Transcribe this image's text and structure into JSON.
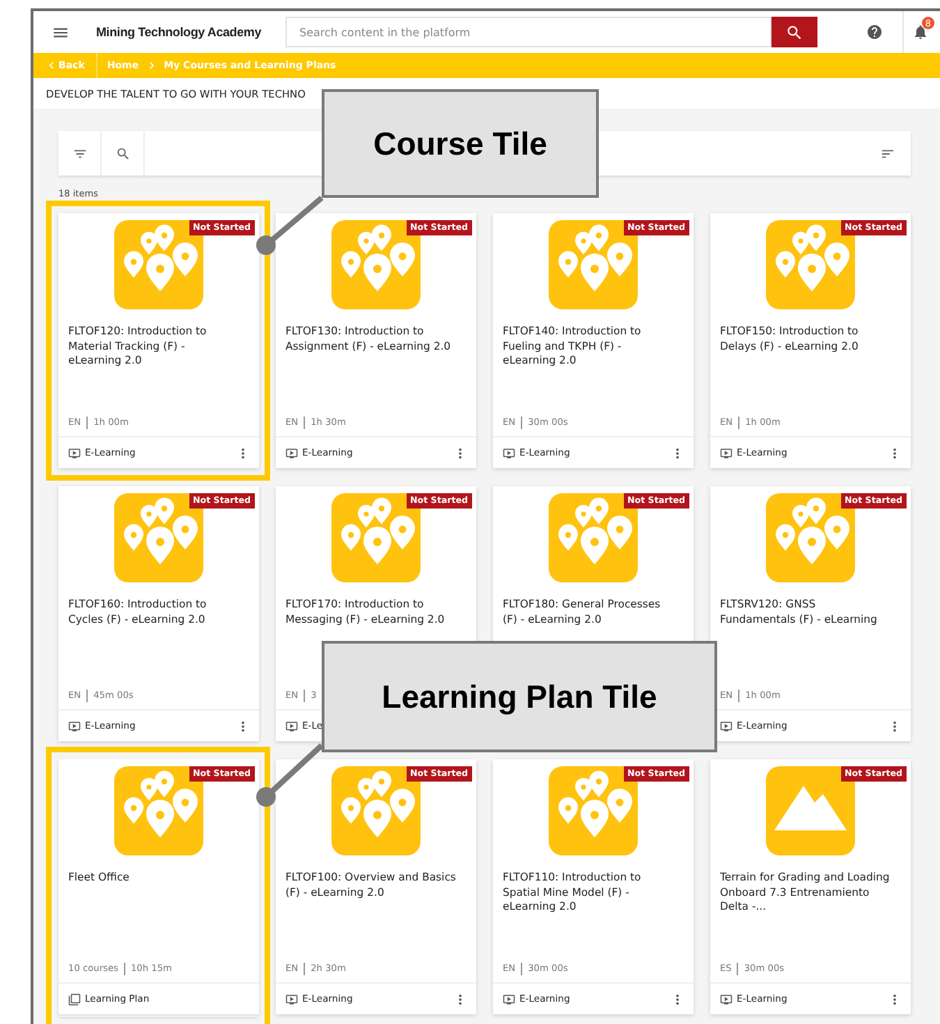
{
  "header": {
    "title": "Mining Technology Academy",
    "search": {
      "placeholder": "Search content in the platform"
    },
    "notifications": "8"
  },
  "breadcrumb": {
    "back": "Back",
    "items": [
      "Home",
      "My Courses and Learning Plans"
    ]
  },
  "tagline": "DEVELOP THE TALENT TO GO WITH YOUR TECHNO",
  "count": "18 items",
  "cards": [
    {
      "kind": "course",
      "image": {
        "kind": "pins"
      },
      "status": "Not Started",
      "title": "FLTOF120: Introduction to Material Tracking (F) - eLearning 2.0",
      "meta": [
        "EN",
        "1h 00m"
      ],
      "footer": "E-Learning",
      "menu": true
    },
    {
      "kind": "course",
      "image": {
        "kind": "pins"
      },
      "status": "Not Started",
      "title": "FLTOF130: Introduction to Assignment (F) - eLearning 2.0",
      "meta": [
        "EN",
        "1h 30m"
      ],
      "footer": "E-Learning",
      "menu": true
    },
    {
      "kind": "course",
      "image": {
        "kind": "pins"
      },
      "status": "Not Started",
      "title": "FLTOF140: Introduction to Fueling and TKPH (F) - eLearning 2.0",
      "meta": [
        "EN",
        "30m 00s"
      ],
      "footer": "E-Learning",
      "menu": true
    },
    {
      "kind": "course",
      "image": {
        "kind": "pins"
      },
      "status": "Not Started",
      "title": "FLTOF150: Introduction to Delays (F) - eLearning 2.0",
      "meta": [
        "EN",
        "1h 00m"
      ],
      "footer": "E-Learning",
      "menu": true
    },
    {
      "kind": "course",
      "image": {
        "kind": "pins"
      },
      "status": "Not Started",
      "title": "FLTOF160: Introduction to Cycles (F) - eLearning 2.0",
      "meta": [
        "EN",
        "45m 00s"
      ],
      "footer": "E-Learning",
      "menu": true
    },
    {
      "kind": "course",
      "image": {
        "kind": "pins"
      },
      "status": "Not Started",
      "title": "FLTOF170: Introduction to Messaging (F) - eLearning 2.0",
      "meta": [
        "EN",
        "3"
      ],
      "footer": "E-Le"
    },
    {
      "kind": "course",
      "image": {
        "kind": "pins"
      },
      "status": "Not Started",
      "title": "FLTOF180: General Processes (F) - eLearning 2.0"
    },
    {
      "kind": "course",
      "image": {
        "kind": "pins"
      },
      "status": "Not Started",
      "title": "FLTSRV120: GNSS Fundamentals (F) - eLearning",
      "meta": [
        "EN",
        "1h 00m"
      ],
      "footer": "E-Learning",
      "menu": true
    },
    {
      "kind": "plan",
      "image": {
        "kind": "pins"
      },
      "status": "Not Started",
      "title": "Fleet Office",
      "meta": [
        "10 courses",
        "10h 15m"
      ],
      "footer": "Learning Plan",
      "menu": false
    },
    {
      "kind": "course",
      "image": {
        "kind": "pins"
      },
      "status": "Not Started",
      "title": "FLTOF100: Overview and Basics (F) - eLearning 2.0",
      "meta": [
        "EN",
        "2h 30m"
      ],
      "footer": "E-Learning",
      "menu": true
    },
    {
      "kind": "course",
      "image": {
        "kind": "pins"
      },
      "status": "Not Started",
      "title": "FLTOF110: Introduction to Spatial Mine Model (F) - eLearning 2.0",
      "meta": [
        "EN",
        "30m 00s"
      ],
      "footer": "E-Learning",
      "menu": true
    },
    {
      "kind": "course",
      "image": {
        "kind": "mountain"
      },
      "status": "Not Started",
      "title": "Terrain for Grading and Loading Onboard 7.3 Entrenamiento Delta -...",
      "meta": [
        "ES",
        "30m 00s"
      ],
      "footer": "E-Learning",
      "menu": true
    }
  ],
  "callouts": [
    {
      "label": "Course Tile"
    },
    {
      "label": "Learning Plan Tile"
    }
  ]
}
